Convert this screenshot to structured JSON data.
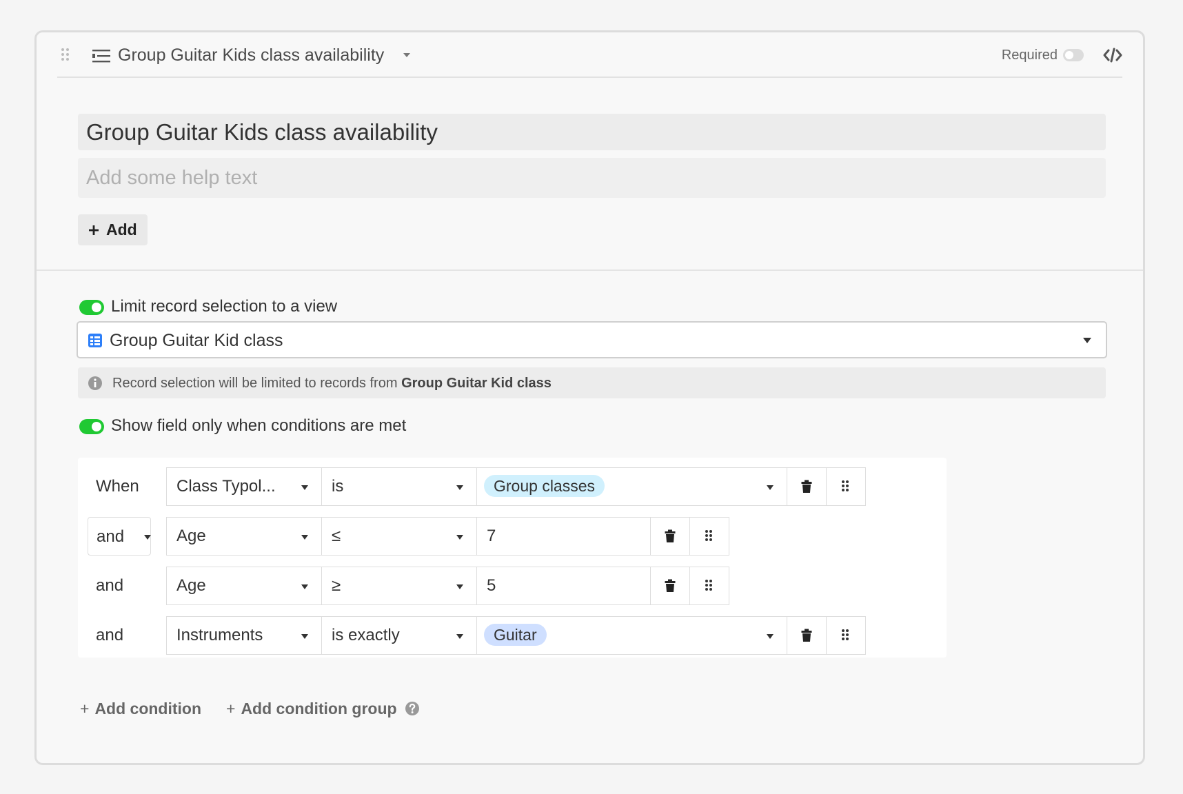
{
  "header": {
    "title": "Group Guitar Kids class availability",
    "required_label": "Required"
  },
  "field": {
    "name_value": "Group Guitar Kids class availability",
    "help_placeholder": "Add some help text",
    "add_label": "Add"
  },
  "limit_view": {
    "toggle_label": "Limit record selection to a view",
    "selected_view": "Group Guitar Kid class",
    "info_text_prefix": "Record selection will be limited to records from",
    "info_text_bold": "Group Guitar Kid class"
  },
  "conditional": {
    "toggle_label": "Show field only when conditions are met",
    "rows": [
      {
        "conjunction": "When",
        "field": "Class Typol...",
        "operator": "is",
        "value": "Group classes"
      },
      {
        "conjunction": "and",
        "field": "Age",
        "operator": "≤",
        "value": "7"
      },
      {
        "conjunction": "and",
        "field": "Age",
        "operator": "≥",
        "value": "5"
      },
      {
        "conjunction": "and",
        "field": "Instruments",
        "operator": "is exactly",
        "value": "Guitar"
      }
    ],
    "add_condition_label": "Add condition",
    "add_group_label": "Add condition group"
  },
  "colors": {
    "toggle_on": "#20c933",
    "pill_cyan": "#d0f0fd",
    "pill_blue": "#cfdfff",
    "grid_icon": "#2d7ff9"
  },
  "icons": [
    "drag-handle-icon",
    "field-type-icon",
    "chevron-down-icon",
    "code-icon",
    "grid-view-icon",
    "info-icon",
    "trash-icon",
    "drag-dots-icon",
    "plus-icon",
    "help-icon"
  ]
}
